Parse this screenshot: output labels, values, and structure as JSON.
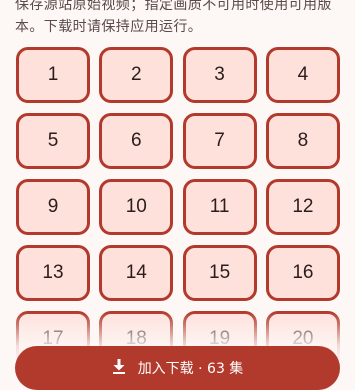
{
  "description": "保存源站原始视频；指定画质不可用时使用可用版本。下载时请保持应用运行。",
  "episodes": [
    "1",
    "2",
    "3",
    "4",
    "5",
    "6",
    "7",
    "8",
    "9",
    "10",
    "11",
    "12",
    "13",
    "14",
    "15",
    "16",
    "17",
    "18",
    "19",
    "20"
  ],
  "download_button": {
    "icon": "download-icon",
    "label": "加入下载 · 63 集"
  },
  "colors": {
    "accent": "#b23a2c",
    "tile_fill": "#ffe1dc",
    "background": "#fdf7f5"
  }
}
